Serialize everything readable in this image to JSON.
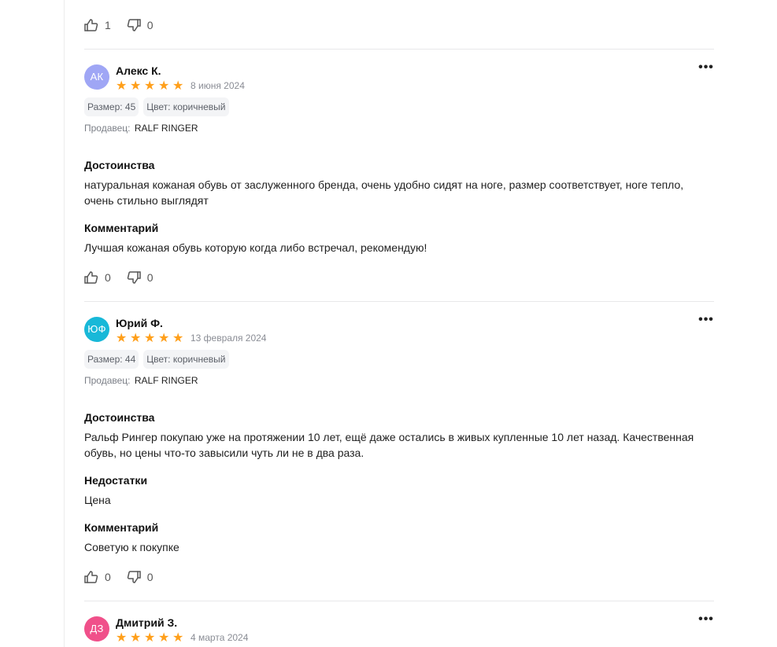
{
  "top_votes": {
    "likes": "1",
    "dislikes": "0"
  },
  "reviews": [
    {
      "initials": "АК",
      "avatar_color": "#9fa6f5",
      "author": "Алекс К.",
      "rating": 5,
      "date": "8 июня 2024",
      "size_chip": "Размер: 45",
      "color_chip": "Цвет: коричневый",
      "seller_label": "Продавец:",
      "seller_name": "RALF RINGER",
      "pros_title": "Достоинства",
      "pros_text": "натуральная кожаная обувь от заслуженного бренда, очень удобно сидят на ноге, размер соответствует, ноге тепло, очень стильно выглядят",
      "comment_title": "Комментарий",
      "comment_text": "Лучшая кожаная обувь которую когда либо встречал, рекомендую!",
      "likes": "0",
      "dislikes": "0"
    },
    {
      "initials": "ЮФ",
      "avatar_color": "#18b8d8",
      "author": "Юрий Ф.",
      "rating": 5,
      "date": "13 февраля 2024",
      "size_chip": "Размер: 44",
      "color_chip": "Цвет: коричневый",
      "seller_label": "Продавец:",
      "seller_name": "RALF RINGER",
      "pros_title": "Достоинства",
      "pros_text": "Ральф Рингер покупаю уже на протяжении 10 лет, ещё даже остались в живых купленные 10 лет назад. Качественная обувь, но цены что-то завысили чуть ли не в два раза.",
      "cons_title": "Недостатки",
      "cons_text": "Цена",
      "comment_title": "Комментарий",
      "comment_text": "Советую к покупке",
      "likes": "0",
      "dislikes": "0"
    },
    {
      "initials": "ДЗ",
      "avatar_color": "#f0508a",
      "author": "Дмитрий З.",
      "rating": 5,
      "date": "4 марта 2024"
    }
  ],
  "colors": {
    "star": "#ff9f1a",
    "chip_bg": "#f3f4f6",
    "divider": "#e8e8ea"
  },
  "icons": {
    "like": "thumbs-up-icon",
    "dislike": "thumbs-down-icon",
    "more": "more-dots-icon",
    "star": "star-icon"
  }
}
